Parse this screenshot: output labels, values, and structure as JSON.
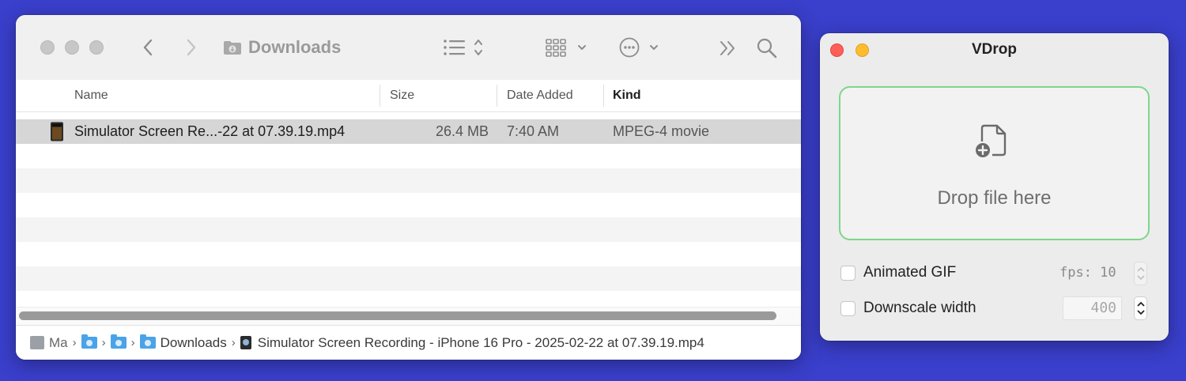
{
  "finder": {
    "title": "Downloads",
    "columns": {
      "name": "Name",
      "size": "Size",
      "date_added": "Date Added",
      "kind": "Kind"
    },
    "file": {
      "name": "Simulator Screen Re...-22 at 07.39.19.mp4",
      "size": "26.4 MB",
      "date_added": "7:40 AM",
      "kind": "MPEG-4 movie"
    },
    "pathbar": {
      "drive": "Ma",
      "folder": "Downloads",
      "file": "Simulator Screen Recording - iPhone 16 Pro - 2025-02-22 at 07.39.19.mp4"
    }
  },
  "vdrop": {
    "title": "VDrop",
    "drop_text": "Drop file here",
    "animated_gif": {
      "label": "Animated GIF",
      "checked": false,
      "fps_label": "fps: 10"
    },
    "downscale": {
      "label": "Downscale width",
      "checked": false,
      "value": "400"
    }
  },
  "colors": {
    "desktop": "#3a3fcc",
    "dropzone_border": "#7ed68a",
    "close": "#ff5f57",
    "minimize": "#febc2e"
  }
}
